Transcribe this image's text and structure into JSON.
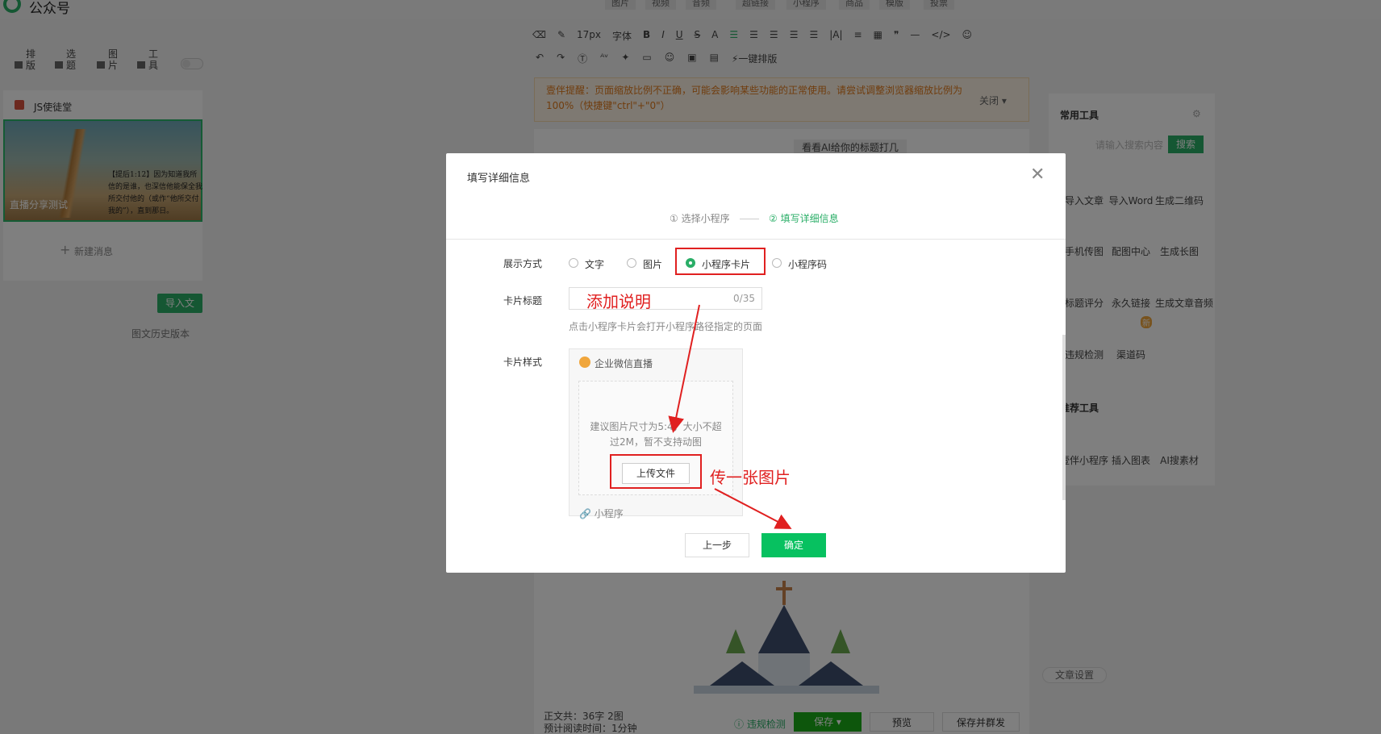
{
  "app": {
    "title": "公众号"
  },
  "top_tabs": [
    "图片",
    "视频",
    "音频",
    "超链接",
    "小程序",
    "商品",
    "模版",
    "投票"
  ],
  "left_tools": [
    {
      "label": "排版"
    },
    {
      "label": "选题"
    },
    {
      "label": "图片"
    },
    {
      "label": "工具"
    }
  ],
  "message": {
    "account": "JS使徒堂",
    "cover_caption": "直播分享测试",
    "verse": "【提后1:12】因为知道我所信的是谁，也深信他能保全我所交付他的（或作“他所交付我的”），直到那日。",
    "new_message": "新建消息",
    "import_label": "导入文",
    "history": "图文历史版本"
  },
  "toolbar": {
    "row1": [
      "17px",
      "字体",
      "B",
      "I",
      "U",
      "S",
      "A",
      "段落",
      "对齐",
      "行距",
      "列表",
      "|A|",
      "表格",
      "引号",
      "—",
      "</>",
      "表情"
    ],
    "row2_one_click": "一键排版"
  },
  "warning": {
    "text": "壹伴提醒：页面缩放比例不正确，可能会影响某些功能的正常使用。请尝试调整浏览器缩放比例为100%（快捷键\"ctrl\"+\"0\"）",
    "close": "关闭"
  },
  "editor": {
    "ai_title": "看看AI给你的标题打几",
    "stats_line1": "正文共：36字 2图",
    "stats_line2": "预计阅读时间：1分钟",
    "check": "违规检测",
    "save": "保存",
    "preview": "预览",
    "save_publish": "保存并群发"
  },
  "right_panel": {
    "title": "常用工具",
    "search_placeholder": "请输入搜索内容",
    "search_btn": "搜索",
    "tools": [
      "导入文章",
      "导入Word",
      "生成二维码",
      "手机传图",
      "配图中心",
      "生成长图",
      "标题评分",
      "永久链接",
      "生成文章音频",
      "违规检测",
      "渠道码"
    ],
    "title2": "推荐工具",
    "tools2": [
      "壹伴小程序",
      "插入图表",
      "AI搜素材"
    ],
    "badge": "新",
    "settings": "文章设置"
  },
  "modal": {
    "title": "填写详细信息",
    "step1": "① 选择小程序",
    "step2": "② 填写详细信息",
    "display_label": "展示方式",
    "options": [
      "文字",
      "图片",
      "小程序卡片",
      "小程序码"
    ],
    "selected": "小程序卡片",
    "card_title_label": "卡片标题",
    "card_title_count": "0/35",
    "hint": "点击小程序卡片会打开小程序路径指定的页面",
    "card_style_label": "卡片样式",
    "card_brand": "企业微信直播",
    "upload_hint": "建议图片尺寸为5:4，大小不超过2M，暂不支持动图",
    "upload_btn": "上传文件",
    "card_footer": "小程序",
    "prev": "上一步",
    "ok": "确定"
  },
  "annotations": {
    "add_desc": "添加说明",
    "upload_pic": "传一张图片"
  },
  "colors": {
    "accent": "#07c160",
    "annotation": "#e02020",
    "warning": "#e07a1c"
  }
}
